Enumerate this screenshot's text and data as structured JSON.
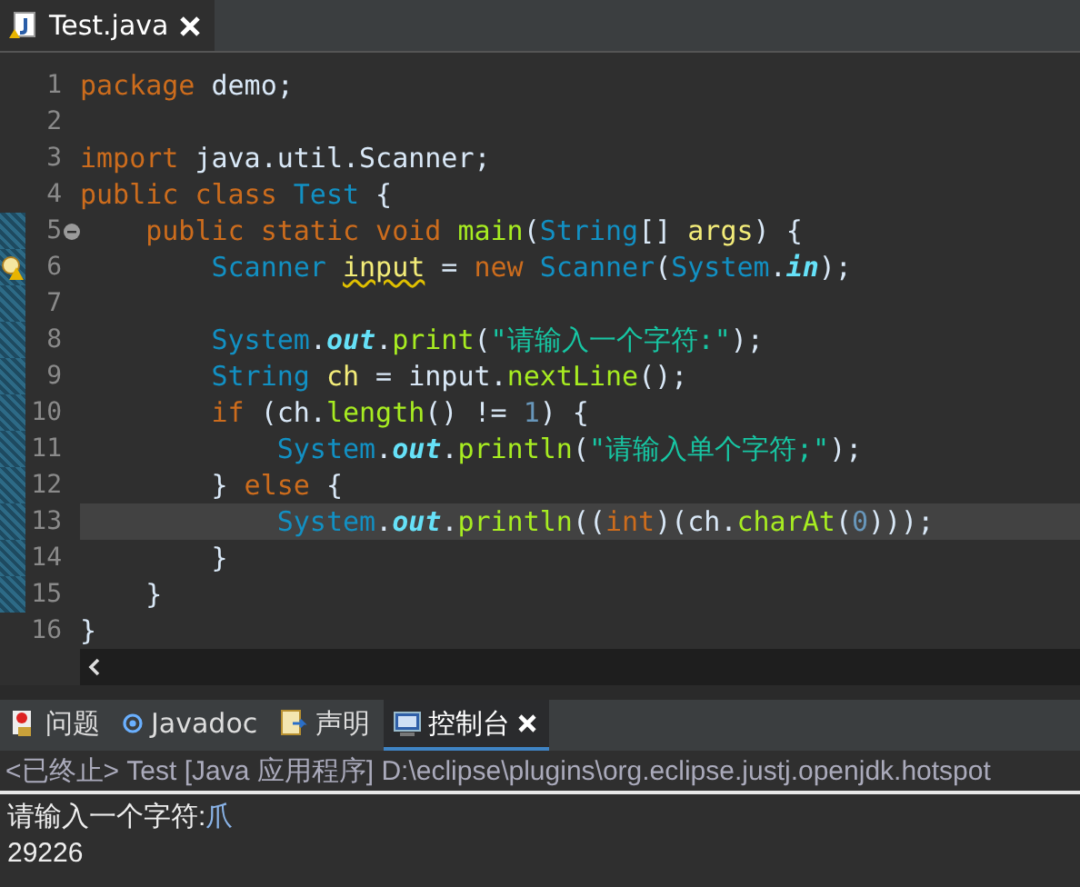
{
  "editor_tab": {
    "title": "Test.java",
    "selected": true
  },
  "editor": {
    "lines": [
      {
        "number": "1",
        "changed": false,
        "current": false,
        "fold_control": false,
        "warning": false,
        "tokens": [
          {
            "kind": "kw",
            "t": "package"
          },
          {
            "kind": "plain",
            "t": " demo;"
          }
        ]
      },
      {
        "number": "2",
        "changed": false,
        "current": false,
        "fold_control": false,
        "warning": false
      },
      {
        "number": "3",
        "changed": false,
        "current": false,
        "fold_control": false,
        "warning": false,
        "tokens": [
          {
            "kind": "kw",
            "t": "import"
          },
          {
            "kind": "plain",
            "t": " java.util.Scanner;"
          }
        ]
      },
      {
        "number": "4",
        "changed": false,
        "current": false,
        "fold_control": false,
        "warning": false,
        "tokens": [
          {
            "kind": "kw",
            "t": "public class"
          },
          {
            "kind": "type",
            "t": " Test"
          },
          {
            "kind": "plain",
            "t": " {"
          }
        ]
      },
      {
        "number": "5",
        "changed": true,
        "current": false,
        "fold_control": true,
        "warning": false,
        "tokens": [
          {
            "kind": "kw",
            "t": "    public static void"
          },
          {
            "kind": "method",
            "t": " main"
          },
          {
            "kind": "plain",
            "t": "("
          },
          {
            "kind": "type",
            "t": "String"
          },
          {
            "kind": "plain",
            "t": "[]"
          },
          {
            "kind": "var",
            "t": " args"
          },
          {
            "kind": "plain",
            "t": ") {"
          }
        ]
      },
      {
        "number": "6",
        "changed": true,
        "current": false,
        "fold_control": false,
        "warning": true,
        "tokens": [
          {
            "kind": "type",
            "t": "        Scanner "
          },
          {
            "kind": "warnvar",
            "t": "input"
          },
          {
            "kind": "plain",
            "t": " ="
          },
          {
            "kind": "kw",
            "t": " new"
          },
          {
            "kind": "type",
            "t": " Scanner"
          },
          {
            "kind": "plain",
            "t": "("
          },
          {
            "kind": "type",
            "t": "System"
          },
          {
            "kind": "plain",
            "t": "."
          },
          {
            "kind": "field",
            "t": "in"
          },
          {
            "kind": "plain",
            "t": ");"
          }
        ]
      },
      {
        "number": "7",
        "changed": true,
        "current": false,
        "fold_control": false,
        "warning": false
      },
      {
        "number": "8",
        "changed": true,
        "current": false,
        "fold_control": false,
        "warning": false,
        "tokens": [
          {
            "kind": "type",
            "t": "        System"
          },
          {
            "kind": "plain",
            "t": "."
          },
          {
            "kind": "field",
            "t": "out"
          },
          {
            "kind": "plain",
            "t": "."
          },
          {
            "kind": "method",
            "t": "print"
          },
          {
            "kind": "plain",
            "t": "("
          },
          {
            "kind": "string",
            "t": "\"请输入一个字符:\""
          },
          {
            "kind": "plain",
            "t": ");"
          }
        ]
      },
      {
        "number": "9",
        "changed": true,
        "current": false,
        "fold_control": false,
        "warning": false,
        "tokens": [
          {
            "kind": "type",
            "t": "        String"
          },
          {
            "kind": "var",
            "t": " ch"
          },
          {
            "kind": "plain",
            "t": " = input."
          },
          {
            "kind": "method",
            "t": "nextLine"
          },
          {
            "kind": "plain",
            "t": "();"
          }
        ]
      },
      {
        "number": "10",
        "changed": true,
        "current": false,
        "fold_control": false,
        "warning": false,
        "tokens": [
          {
            "kind": "kw",
            "t": "        if"
          },
          {
            "kind": "plain",
            "t": " (ch."
          },
          {
            "kind": "method",
            "t": "length"
          },
          {
            "kind": "plain",
            "t": "() !="
          },
          {
            "kind": "number",
            "t": " 1"
          },
          {
            "kind": "plain",
            "t": ") {"
          }
        ]
      },
      {
        "number": "11",
        "changed": true,
        "current": false,
        "fold_control": false,
        "warning": false,
        "tokens": [
          {
            "kind": "type",
            "t": "            System"
          },
          {
            "kind": "plain",
            "t": "."
          },
          {
            "kind": "field",
            "t": "out"
          },
          {
            "kind": "plain",
            "t": "."
          },
          {
            "kind": "method",
            "t": "println"
          },
          {
            "kind": "plain",
            "t": "("
          },
          {
            "kind": "string",
            "t": "\"请输入单个字符;\""
          },
          {
            "kind": "plain",
            "t": ");"
          }
        ]
      },
      {
        "number": "12",
        "changed": true,
        "current": false,
        "fold_control": false,
        "warning": false,
        "tokens": [
          {
            "kind": "plain",
            "t": "        }"
          },
          {
            "kind": "kw",
            "t": " else"
          },
          {
            "kind": "plain",
            "t": " {"
          }
        ]
      },
      {
        "number": "13",
        "changed": true,
        "current": true,
        "fold_control": false,
        "warning": false,
        "tokens": [
          {
            "kind": "type",
            "t": "            System"
          },
          {
            "kind": "plain",
            "t": "."
          },
          {
            "kind": "field",
            "t": "out"
          },
          {
            "kind": "plain",
            "t": "."
          },
          {
            "kind": "method",
            "t": "println"
          },
          {
            "kind": "plain",
            "t": "(("
          },
          {
            "kind": "kw",
            "t": "int"
          },
          {
            "kind": "plain",
            "t": ")(ch."
          },
          {
            "kind": "method",
            "t": "charAt"
          },
          {
            "kind": "plain",
            "t": "("
          },
          {
            "kind": "number",
            "t": "0"
          },
          {
            "kind": "plain",
            "t": ")));"
          }
        ]
      },
      {
        "number": "14",
        "changed": true,
        "current": false,
        "fold_control": false,
        "warning": false,
        "tokens": [
          {
            "kind": "plain",
            "t": "        }"
          }
        ]
      },
      {
        "number": "15",
        "changed": true,
        "current": false,
        "fold_control": false,
        "warning": false,
        "tokens": [
          {
            "kind": "plain",
            "t": "    }"
          }
        ]
      },
      {
        "number": "16",
        "changed": false,
        "current": false,
        "fold_control": false,
        "warning": false,
        "tokens": [
          {
            "kind": "plain",
            "t": "}"
          }
        ]
      }
    ]
  },
  "panel_tabs": [
    {
      "label": "问题",
      "selected": false
    },
    {
      "label": "Javadoc",
      "selected": false
    },
    {
      "label": "声明",
      "selected": false
    },
    {
      "label": "控制台",
      "selected": true
    }
  ],
  "console": {
    "header": "<已终止> Test [Java 应用程序] D:\\eclipse\\plugins\\org.eclipse.justj.openjdk.hotspot",
    "output": [
      {
        "segments": [
          {
            "kind": "output",
            "text": "请输入一个字符:"
          },
          {
            "kind": "input",
            "text": "爪"
          }
        ]
      },
      {
        "segments": [
          {
            "kind": "output",
            "text": "29226"
          }
        ]
      }
    ]
  }
}
